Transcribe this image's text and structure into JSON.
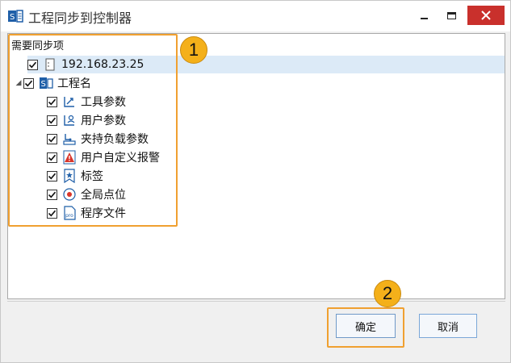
{
  "window": {
    "title": "工程同步到控制器",
    "accent_close": "#c9302c"
  },
  "tree": {
    "header": "需要同步项",
    "controller_ip": "192.168.23.25",
    "project": {
      "label": "工程名",
      "expanded": true,
      "items": [
        {
          "label": "工具参数",
          "icon": "tool-params-icon",
          "checked": true
        },
        {
          "label": "用户参数",
          "icon": "user-params-icon",
          "checked": true
        },
        {
          "label": "夹持负载参数",
          "icon": "payload-params-icon",
          "checked": true
        },
        {
          "label": "用户自定义报警",
          "icon": "custom-alarm-icon",
          "checked": true
        },
        {
          "label": "标签",
          "icon": "bookmark-icon",
          "checked": true
        },
        {
          "label": "全局点位",
          "icon": "global-point-icon",
          "checked": true
        },
        {
          "label": "程序文件",
          "icon": "program-file-icon",
          "checked": true
        }
      ]
    }
  },
  "annotations": {
    "badge1": "1",
    "badge2": "2",
    "color": "#f0a030"
  },
  "buttons": {
    "ok": "确定",
    "cancel": "取消"
  }
}
